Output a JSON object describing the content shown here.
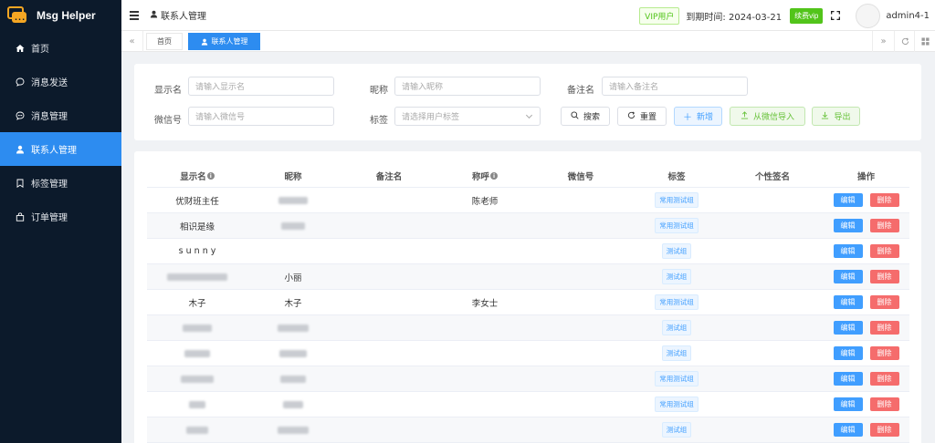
{
  "app": {
    "title": "Msg Helper"
  },
  "sidebar": {
    "items": [
      {
        "label": "首页",
        "icon": "home-icon"
      },
      {
        "label": "消息发送",
        "icon": "chat-bubble-icon"
      },
      {
        "label": "消息管理",
        "icon": "chat-dots-icon"
      },
      {
        "label": "联系人管理",
        "icon": "user-icon",
        "active": true
      },
      {
        "label": "标签管理",
        "icon": "bookmark-icon"
      },
      {
        "label": "订单管理",
        "icon": "bag-icon"
      }
    ]
  },
  "header": {
    "breadcrumb": "联系人管理",
    "vip_label": "VIP用户",
    "expire_text": "到期时间: 2024-03-21",
    "renew_label": "续费vip",
    "username": "admin4-1"
  },
  "tabs": [
    {
      "label": "首页"
    },
    {
      "label": "联系人管理",
      "active": true
    }
  ],
  "search": {
    "display_name": {
      "label": "显示名",
      "placeholder": "请输入显示名"
    },
    "nickname": {
      "label": "昵称",
      "placeholder": "请输入昵称"
    },
    "remark": {
      "label": "备注名",
      "placeholder": "请输入备注名"
    },
    "wechat": {
      "label": "微信号",
      "placeholder": "请输入微信号"
    },
    "tag": {
      "label": "标签",
      "placeholder": "请选择用户标签"
    },
    "buttons": {
      "search": "搜索",
      "reset": "重置",
      "add": "新增",
      "import": "从微信导入",
      "export": "导出"
    }
  },
  "table": {
    "columns": [
      "显示名",
      "昵称",
      "备注名",
      "称呼",
      "微信号",
      "标签",
      "个性签名",
      "操作"
    ],
    "edit_label": "编辑",
    "delete_label": "删除",
    "rows": [
      {
        "display_name": "优财班主任",
        "nickname": "",
        "remark": "",
        "salutation": "陈老师",
        "wechat": "",
        "tag": "常用测试组",
        "signature": ""
      },
      {
        "display_name": "相识是缘",
        "nickname": "",
        "remark": "",
        "salutation": "",
        "wechat": "",
        "tag": "常用测试组",
        "signature": ""
      },
      {
        "display_name": "s u n n y",
        "nickname": "",
        "remark": "",
        "salutation": "",
        "wechat": "",
        "tag": "测试组",
        "signature": ""
      },
      {
        "display_name": "",
        "nickname": "小丽",
        "remark": "",
        "salutation": "",
        "wechat": "",
        "tag": "测试组",
        "signature": ""
      },
      {
        "display_name": "木子",
        "nickname": "木子",
        "remark": "",
        "salutation": "李女士",
        "wechat": "",
        "tag": "常用测试组",
        "signature": ""
      },
      {
        "display_name": "",
        "nickname": "",
        "remark": "",
        "salutation": "",
        "wechat": "",
        "tag": "测试组",
        "signature": ""
      },
      {
        "display_name": "",
        "nickname": "",
        "remark": "",
        "salutation": "",
        "wechat": "",
        "tag": "测试组",
        "signature": ""
      },
      {
        "display_name": "",
        "nickname": "",
        "remark": "",
        "salutation": "",
        "wechat": "",
        "tag": "常用测试组",
        "signature": ""
      },
      {
        "display_name": "",
        "nickname": "",
        "remark": "",
        "salutation": "",
        "wechat": "",
        "tag": "常用测试组",
        "signature": ""
      },
      {
        "display_name": "",
        "nickname": "",
        "remark": "",
        "salutation": "",
        "wechat": "",
        "tag": "测试组",
        "signature": ""
      }
    ]
  }
}
